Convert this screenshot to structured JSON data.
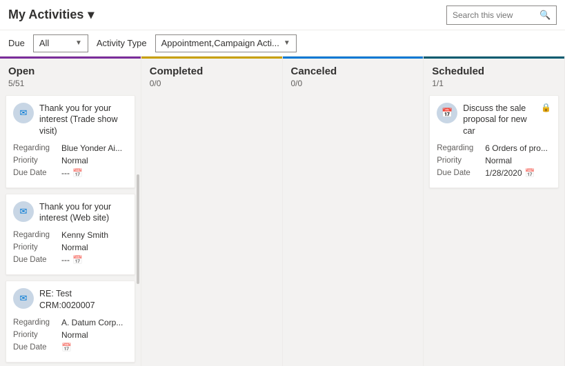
{
  "header": {
    "title": "My Activities",
    "chevron": "▾",
    "search_placeholder": "Search this view",
    "search_icon": "🔍"
  },
  "filters": {
    "due_label": "Due",
    "due_value": "All",
    "activity_type_label": "Activity Type",
    "activity_type_value": "Appointment,Campaign Acti..."
  },
  "columns": [
    {
      "id": "open",
      "title": "Open",
      "count": "5/51",
      "color_class": "open",
      "cards": [
        {
          "icon": "✉",
          "title": "Thank you for your interest (Trade show visit)",
          "regarding_label": "Regarding",
          "regarding_value": "Blue Yonder Ai...",
          "priority_label": "Priority",
          "priority_value": "Normal",
          "due_date_label": "Due Date",
          "due_date_value": "---",
          "show_lock": false
        },
        {
          "icon": "✉",
          "title": "Thank you for your interest (Web site)",
          "regarding_label": "Regarding",
          "regarding_value": "Kenny Smith",
          "priority_label": "Priority",
          "priority_value": "Normal",
          "due_date_label": "Due Date",
          "due_date_value": "---",
          "show_lock": false
        },
        {
          "icon": "✉",
          "title": "RE: Test CRM:0020007",
          "regarding_label": "Regarding",
          "regarding_value": "A. Datum Corp...",
          "priority_label": "Priority",
          "priority_value": "Normal",
          "due_date_label": "Due Date",
          "due_date_value": "",
          "show_lock": false
        }
      ]
    },
    {
      "id": "completed",
      "title": "Completed",
      "count": "0/0",
      "color_class": "completed",
      "cards": []
    },
    {
      "id": "canceled",
      "title": "Canceled",
      "count": "0/0",
      "color_class": "canceled",
      "cards": []
    },
    {
      "id": "scheduled",
      "title": "Scheduled",
      "count": "1/1",
      "color_class": "scheduled",
      "cards": [
        {
          "icon": "📅",
          "title": "Discuss the sale proposal for new car",
          "regarding_label": "Regarding",
          "regarding_value": "6 Orders of pro...",
          "priority_label": "Priority",
          "priority_value": "Normal",
          "due_date_label": "Due Date",
          "due_date_value": "1/28/2020",
          "show_lock": true
        }
      ]
    }
  ]
}
